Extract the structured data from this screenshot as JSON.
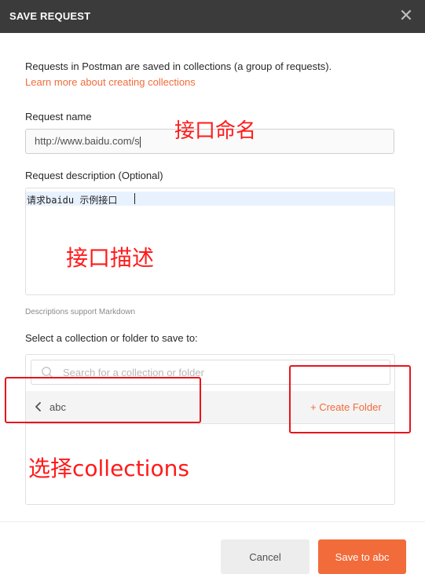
{
  "dialog": {
    "title": "SAVE REQUEST",
    "close_glyph": "✕"
  },
  "intro": {
    "text": "Requests in Postman are saved in collections (a group of requests).",
    "link": "Learn more about creating collections"
  },
  "request_name": {
    "label": "Request name",
    "value": "http://www.baidu.com/s"
  },
  "request_description": {
    "label": "Request description (Optional)",
    "value": "请求baidu 示例接口",
    "hint": "Descriptions support Markdown"
  },
  "collection_picker": {
    "label": "Select a collection or folder to save to:",
    "search_placeholder": "Search for a collection or folder",
    "search_icon": "search-icon",
    "back_icon": "chevron-left-icon",
    "current_collection": "abc",
    "create_folder": "+ Create Folder"
  },
  "annotations": {
    "name": "接口命名",
    "description": "接口描述",
    "collections": "选择collections"
  },
  "footer": {
    "cancel_label": "Cancel",
    "save_label": "Save to abc"
  },
  "colors": {
    "title_bar": "#3b3b3b",
    "accent": "#f26b3a",
    "annotation": "#ff1a1a",
    "panel_row": "#f4f4f4"
  }
}
